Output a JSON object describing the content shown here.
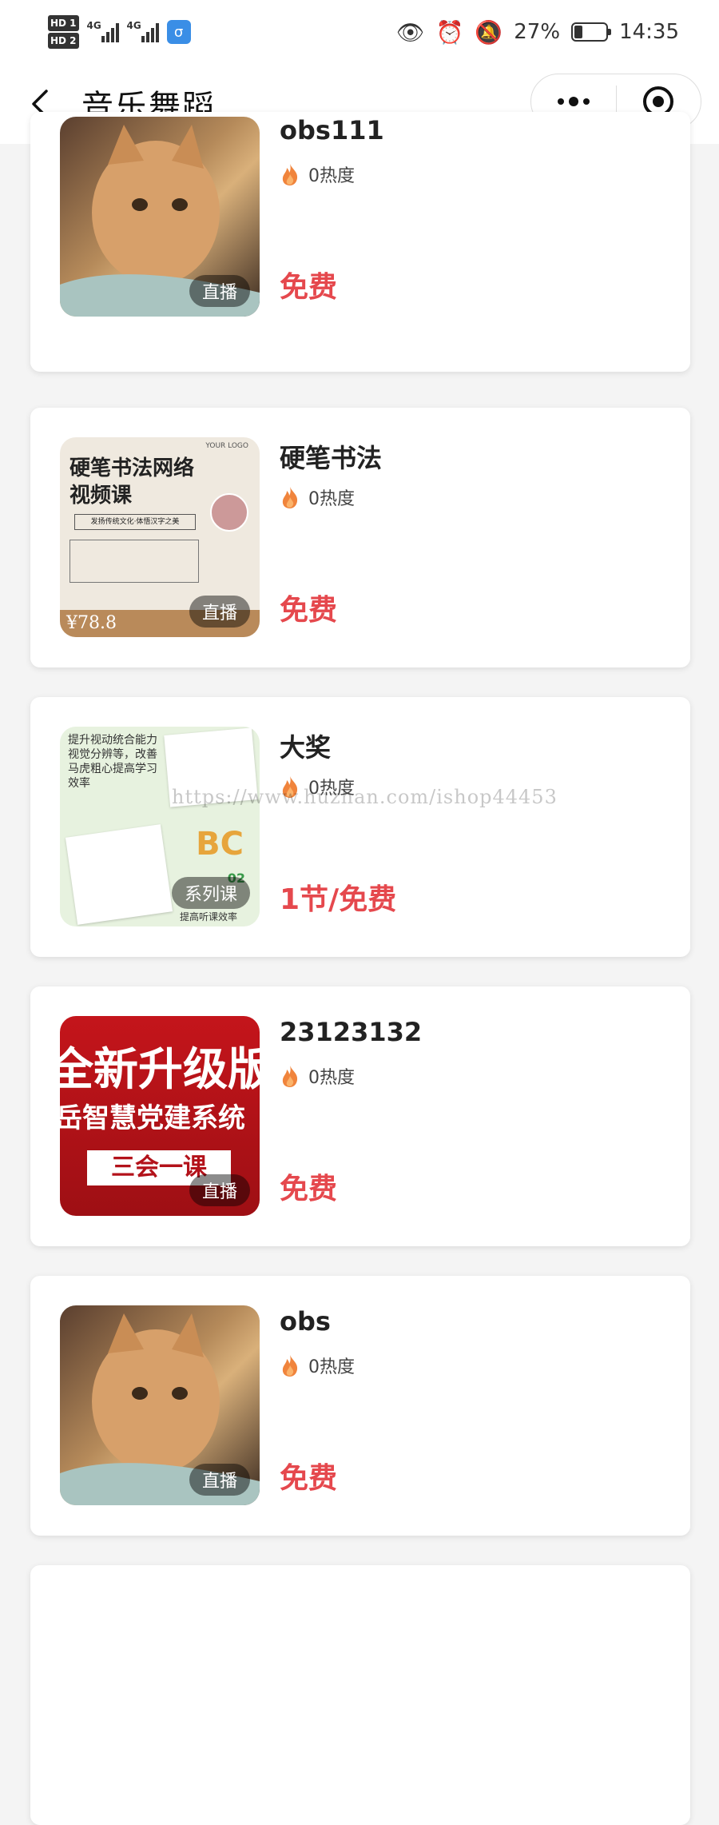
{
  "status_bar": {
    "hd1": "HD 1",
    "hd2": "HD 2",
    "net1": "4G",
    "net2": "4G",
    "battery_percent": "27%",
    "battery_level": 0.27,
    "time": "14:35"
  },
  "nav": {
    "title": "音乐舞蹈"
  },
  "items": [
    {
      "title": "obs111",
      "heat": "0热度",
      "price": "免费",
      "badge": "直播",
      "thumb": "cat"
    },
    {
      "title": "硬笔书法",
      "heat": "0热度",
      "price": "免费",
      "badge": "直播",
      "thumb": "calligraphy",
      "thumb_text": {
        "title": "硬笔书法网络视频课",
        "sub": "发扬传统文化·体悟汉字之美",
        "logo": "YOUR LOGO",
        "price": "¥78.8"
      }
    },
    {
      "title": "大奖",
      "heat": "0热度",
      "price": "1节/免费",
      "badge": "系列课",
      "thumb": "series",
      "thumb_text": {
        "text": "提升视动统合能力视觉分辨等，改善马虎粗心提高学习效率",
        "abc": "BC",
        "num": "02",
        "small": "提高听课效率"
      }
    },
    {
      "title": "23123132",
      "heat": "0热度",
      "price": "免费",
      "badge": "直播",
      "thumb": "red",
      "thumb_text": {
        "l1": "全新升级版",
        "l2": "岳智慧党建系统",
        "l3": "三会一课"
      }
    },
    {
      "title": "obs",
      "heat": "0热度",
      "price": "免费",
      "badge": "直播",
      "thumb": "cat"
    }
  ],
  "watermark": "https://www.huzhan.com/ishop44453",
  "colors": {
    "price_red": "#e5484d",
    "flame": "#f0843c"
  }
}
